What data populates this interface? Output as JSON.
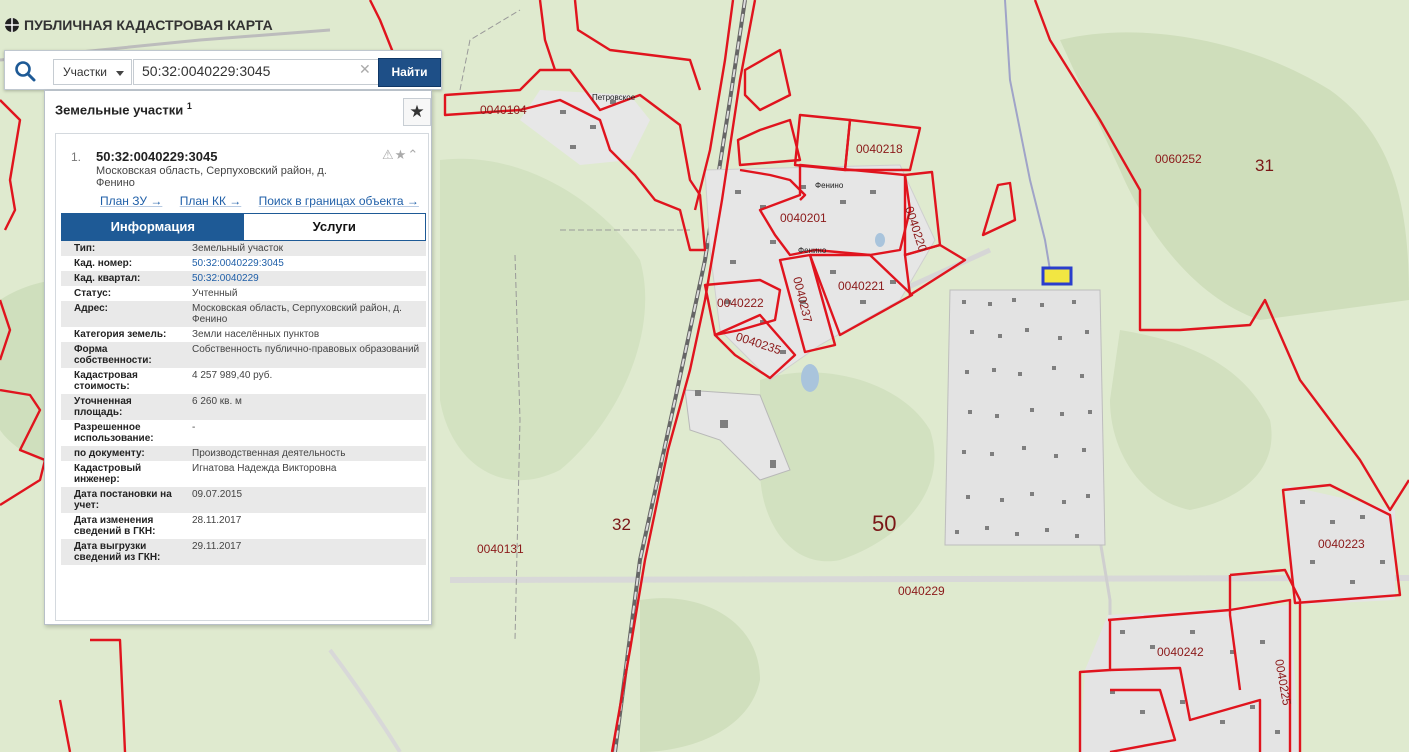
{
  "app": {
    "title": "ПУБЛИЧНАЯ КАДАСТРОВАЯ КАРТА"
  },
  "search": {
    "type_label": "Участки",
    "query": "50:32:0040229:3045",
    "find_button": "Найти"
  },
  "results": {
    "header": "Земельные участки",
    "count": "1",
    "item": {
      "num": "1.",
      "title": "50:32:0040229:3045",
      "address": "Московская область, Серпуховский район, д. Фенино",
      "links": [
        "План ЗУ →",
        "План КК →",
        "Поиск в границах объекта →"
      ]
    },
    "tabs": [
      "Информация",
      "Услуги"
    ],
    "rows": [
      {
        "k": "Тип:",
        "v": "Земельный участок"
      },
      {
        "k": "Кад. номер:",
        "v": "50:32:0040229:3045",
        "link": true
      },
      {
        "k": "Кад. квартал:",
        "v": "50:32:0040229",
        "link": true
      },
      {
        "k": "Статус:",
        "v": "Учтенный"
      },
      {
        "k": "Адрес:",
        "v": "Московская область, Серпуховский район, д. Фенино"
      },
      {
        "k": "Категория земель:",
        "v": "Земли населённых пунктов"
      },
      {
        "k": "Форма собственности:",
        "v": "Собственность публично-правовых образований"
      },
      {
        "k": "Кадастровая стоимость:",
        "v": "4 257 989,40 руб."
      },
      {
        "k": "Уточненная площадь:",
        "v": "6 260 кв. м"
      },
      {
        "k": "Разрешенное использование:",
        "v": "-"
      },
      {
        "k": "по документу:",
        "v": "Производственная деятельность"
      },
      {
        "k": "Кадастровый инженер:",
        "v": "Игнатова Надежда Викторовна"
      },
      {
        "k": "Дата постановки на учет:",
        "v": "09.07.2015"
      },
      {
        "k": "Дата изменения сведений в ГКН:",
        "v": "28.11.2017"
      },
      {
        "k": "Дата выгрузки сведений из ГКН:",
        "v": "29.11.2017"
      }
    ]
  },
  "map_labels": {
    "region": "50",
    "district_32": "32",
    "district_31": "31",
    "q_0040104": "0040104",
    "q_0040218": "0040218",
    "q_0040201": "0040201",
    "q_0040220": "0040220",
    "q_0040221": "0040221",
    "q_0040222": "0040222",
    "q_0040237": "0040237",
    "q_0040235": "0040235",
    "q_0060252": "0060252",
    "q_0040131": "0040131",
    "q_0040229": "0040229",
    "q_0040223": "0040223",
    "q_0040242": "0040242",
    "q_0040225": "0040225",
    "village_1": "Петровское",
    "village_2": "Фенино",
    "village_3": "Фенино"
  },
  "colors": {
    "boundary": "#e0141e",
    "selected": "#2a3ecc",
    "selected_fill": "#f2e642",
    "primary": "#1e5a96"
  }
}
